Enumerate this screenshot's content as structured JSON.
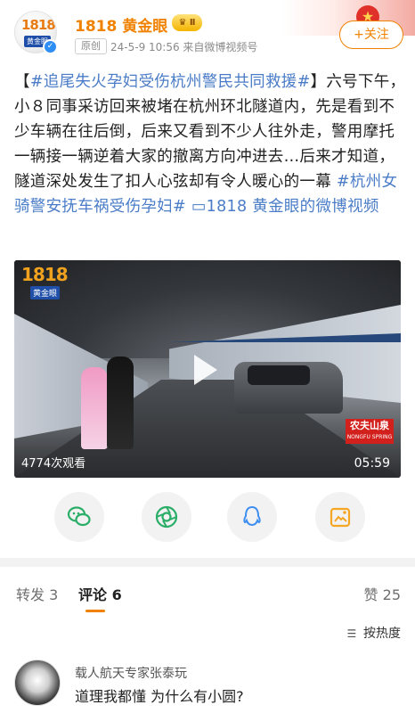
{
  "header": {
    "username": "1818 黄金眼",
    "vip_badge": "♛ Ⅱ",
    "original_tag": "原创",
    "meta": "24-5-9 10:56  来自微博视频号",
    "follow_label": "+关注",
    "avatar_logo_number": "1818",
    "avatar_logo_sub": "黄金眼"
  },
  "post": {
    "bracket_open": "【",
    "topic1": "#追尾失火孕妇受伤杭州警民共同救援#",
    "bracket_close": "】",
    "body": "六号下午，小８同事采访回来被堵在杭州环北隧道内，先是看到不少车辆在往后倒，后来又看到不少人往外走，警用摩托一辆接一辆逆着大家的撤离方向冲进去…后来才知道，隧道深处发生了扣人心弦却有令人暖心的一幕 ",
    "topic2": "#杭州女骑警安抚车祸受伤孕妇#",
    "video_link": " ▭1818 黄金眼的微博视频"
  },
  "video": {
    "logo_number": "1818",
    "logo_sub": "黄金眼",
    "views": "4774次观看",
    "duration": "05:59",
    "sponsor_main": "农夫山泉",
    "sponsor_sub": "NONGFU SPRING"
  },
  "share_buttons": [
    {
      "icon": "wechat-icon",
      "color": "#2aae67"
    },
    {
      "icon": "moments-icon",
      "color": "#2aae67"
    },
    {
      "icon": "qq-icon",
      "color": "#3d8ef0"
    },
    {
      "icon": "save-image-icon",
      "color": "#f5a623"
    }
  ],
  "tabs": {
    "repost": "转发 3",
    "comments": "评论 6",
    "likes": "赞 25"
  },
  "sort_label": "按热度",
  "comment": {
    "user": "载人航天专家张泰玩",
    "text": "道理我都懂 为什么有小圆?"
  },
  "colors": {
    "accent": "#f08200",
    "link": "#4a7cc7"
  }
}
